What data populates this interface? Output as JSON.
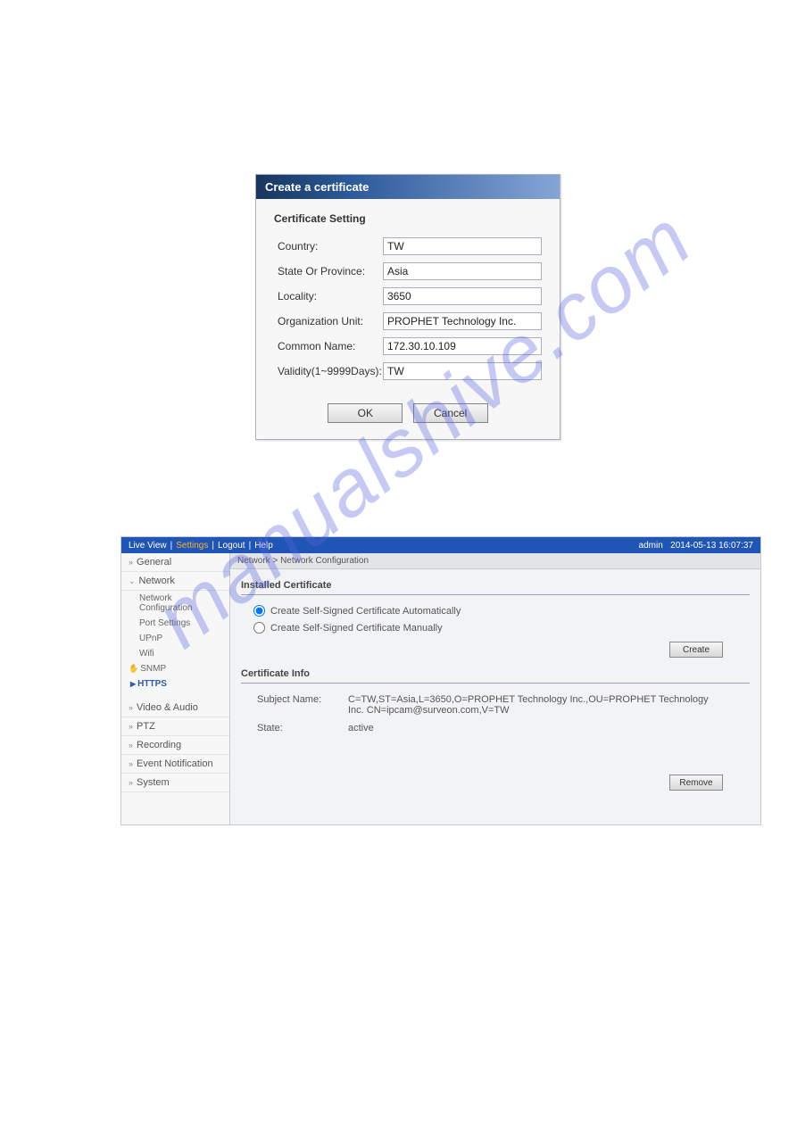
{
  "dialog": {
    "title": "Create a certificate",
    "section": "Certificate Setting",
    "fields": {
      "country": {
        "label": "Country:",
        "value": "TW"
      },
      "state": {
        "label": "State Or Province:",
        "value": "Asia"
      },
      "locality": {
        "label": "Locality:",
        "value": "3650"
      },
      "org": {
        "label": "Organization Unit:",
        "value": "PROPHET Technology Inc."
      },
      "cn": {
        "label": "Common Name:",
        "value": "172.30.10.109"
      },
      "validity": {
        "label": "Validity(1~9999Days):",
        "value": "TW"
      }
    },
    "ok": "OK",
    "cancel": "Cancel"
  },
  "page": {
    "topbar": {
      "live": "Live View",
      "settings": "Settings",
      "logout": "Logout",
      "help": "Help",
      "user": "admin",
      "time": "2014-05-13 16:07:37"
    },
    "sidebar": {
      "general": "General",
      "network": "Network",
      "items": {
        "netcfg": "Network Configuration",
        "port": "Port Settings",
        "upnp": "UPnP",
        "wifi": "Wifi",
        "snmp": "SNMP",
        "https": "HTTPS"
      },
      "video": "Video & Audio",
      "ptz": "PTZ",
      "recording": "Recording",
      "event": "Event Notification",
      "system": "System"
    },
    "breadcrumb": "Network > Network Configuration",
    "installed": {
      "title": "Installed Certificate",
      "auto": "Create Self-Signed Certificate Automatically",
      "manual": "Create Self-Signed Certificate Manually",
      "create": "Create"
    },
    "certinfo": {
      "title": "Certificate Info",
      "subject_label": "Subject Name:",
      "subject_value": "C=TW,ST=Asia,L=3650,O=PROPHET Technology Inc.,OU=PROPHET Technology Inc. CN=ipcam@surveon.com,V=TW",
      "state_label": "State:",
      "state_value": "active",
      "remove": "Remove"
    }
  },
  "watermark": "manualshive.com"
}
